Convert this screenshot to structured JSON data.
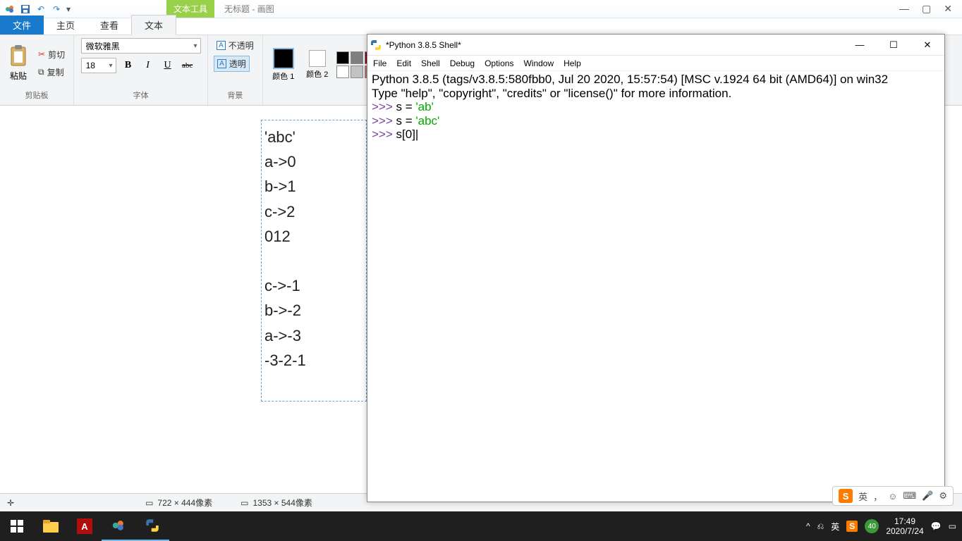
{
  "paint": {
    "title_context_tab": "文本工具",
    "doc_title": "无标题 - 画图",
    "tabs": {
      "file": "文件",
      "home": "主页",
      "view": "查看",
      "text": "文本"
    },
    "clipboard": {
      "paste": "粘贴",
      "cut": "剪切",
      "copy": "复制",
      "group_label": "剪贴板"
    },
    "font": {
      "family": "微软雅黑",
      "size": "18",
      "group_label": "字体",
      "bold": "B",
      "italic": "I",
      "underline": "U",
      "strike": "abc"
    },
    "bg": {
      "opaque": "不透明",
      "transparent": "透明",
      "group_label": "背景"
    },
    "color": {
      "c1": "颜色 1",
      "c2": "颜色 2"
    },
    "palette": [
      "#000000",
      "#7f7f7f",
      "#880015",
      "#ed1c24",
      "#ff7f27",
      "#fff200",
      "#22b14c",
      "#ffffff",
      "#c3c3c3",
      "#b97a57",
      "#ffaec9",
      "#ffc90e",
      "#efe4b0",
      "#b5e61d"
    ],
    "textbox_lines": [
      "'abc'",
      "a->0",
      "b->1",
      "c->2",
      "012",
      "",
      "c->-1",
      "b->-2",
      "a->-3",
      "-3-2-1"
    ],
    "status": {
      "cursor": "",
      "sel": "722 × 444像素",
      "canvas": "1353 × 544像素"
    }
  },
  "idle": {
    "title": "*Python 3.8.5 Shell*",
    "menu": [
      "File",
      "Edit",
      "Shell",
      "Debug",
      "Options",
      "Window",
      "Help"
    ],
    "banner1": "Python 3.8.5 (tags/v3.8.5:580fbb0, Jul 20 2020, 15:57:54) [MSC v.1924 64 bit (AMD64)] on win32",
    "banner2": "Type \"help\", \"copyright\", \"credits\" or \"license()\" for more information.",
    "prompt": ">>> ",
    "lines": [
      {
        "code": "s = ",
        "str": "'ab'"
      },
      {
        "code": "s = ",
        "str": "'abc'"
      },
      {
        "code": "s[0]",
        "str": ""
      }
    ]
  },
  "ime": {
    "lang": "英",
    "comma": "，"
  },
  "tray": {
    "lang": "英",
    "time": "17:49",
    "date": "2020/7/24",
    "badge": "40"
  }
}
